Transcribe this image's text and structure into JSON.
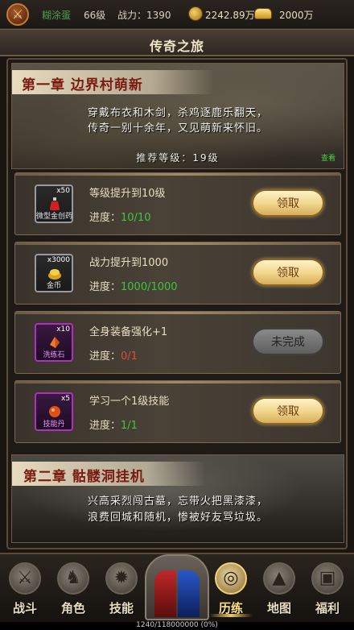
{
  "topbar": {
    "player_name": "糊涂蛋",
    "level": "66级",
    "power_label": "战力：1390",
    "coins": "2242.89万",
    "ingots": "2000万"
  },
  "header": {
    "title": "传奇之旅"
  },
  "chapter1": {
    "title": "第一章    边界村萌新",
    "desc_line1": "穿戴布衣和木剑，杀鸡逐鹿乐翻天，",
    "desc_line2": "传奇一别十余年，又见萌新来怀旧。",
    "recommend": "推荐等级：19级",
    "artist_tag": "查看"
  },
  "progress_label": "进度：",
  "tasks": [
    {
      "name": "等级提升到10级",
      "progress": "10/10",
      "state": "done",
      "button": "领取",
      "item": {
        "qty": "x50",
        "name": "微型金创药",
        "icon": "red-potion-icon",
        "rarity": "normal"
      }
    },
    {
      "name": "战力提升到1000",
      "progress": "1000/1000",
      "state": "done",
      "button": "领取",
      "item": {
        "qty": "x3000",
        "name": "金币",
        "icon": "gold-coin-pile-icon",
        "rarity": "normal"
      }
    },
    {
      "name": "全身装备强化+1",
      "progress": "0/1",
      "state": "todo",
      "button": "未完成",
      "item": {
        "qty": "x10",
        "name": "洗练石",
        "icon": "refine-stone-icon",
        "rarity": "epic"
      }
    },
    {
      "name": "学习一个1级技能",
      "progress": "1/1",
      "state": "done",
      "button": "领取",
      "item": {
        "qty": "x5",
        "name": "技能丹",
        "icon": "skill-pill-icon",
        "rarity": "epic"
      }
    }
  ],
  "chapter2": {
    "title": "第二章    骷髅洞挂机",
    "desc_line1": "兴高采烈闯古墓，忘带火把黑漆漆，",
    "desc_line2": "浪费回城和随机，惨被好友骂垃圾。"
  },
  "nav": [
    {
      "label": "战斗",
      "icon": "crossed-swords-icon"
    },
    {
      "label": "角色",
      "icon": "helmet-icon"
    },
    {
      "label": "技能",
      "icon": "flame-icon"
    },
    {
      "label": "历练",
      "icon": "spiral-icon",
      "active": true
    },
    {
      "label": "地图",
      "icon": "mountain-icon"
    },
    {
      "label": "福利",
      "icon": "chest-icon"
    }
  ],
  "exp": "1240/118000000 (0%)",
  "colors": {
    "done": "#3fc43f",
    "todo": "#e04a3a",
    "accent_gold": "#f0d48a"
  }
}
